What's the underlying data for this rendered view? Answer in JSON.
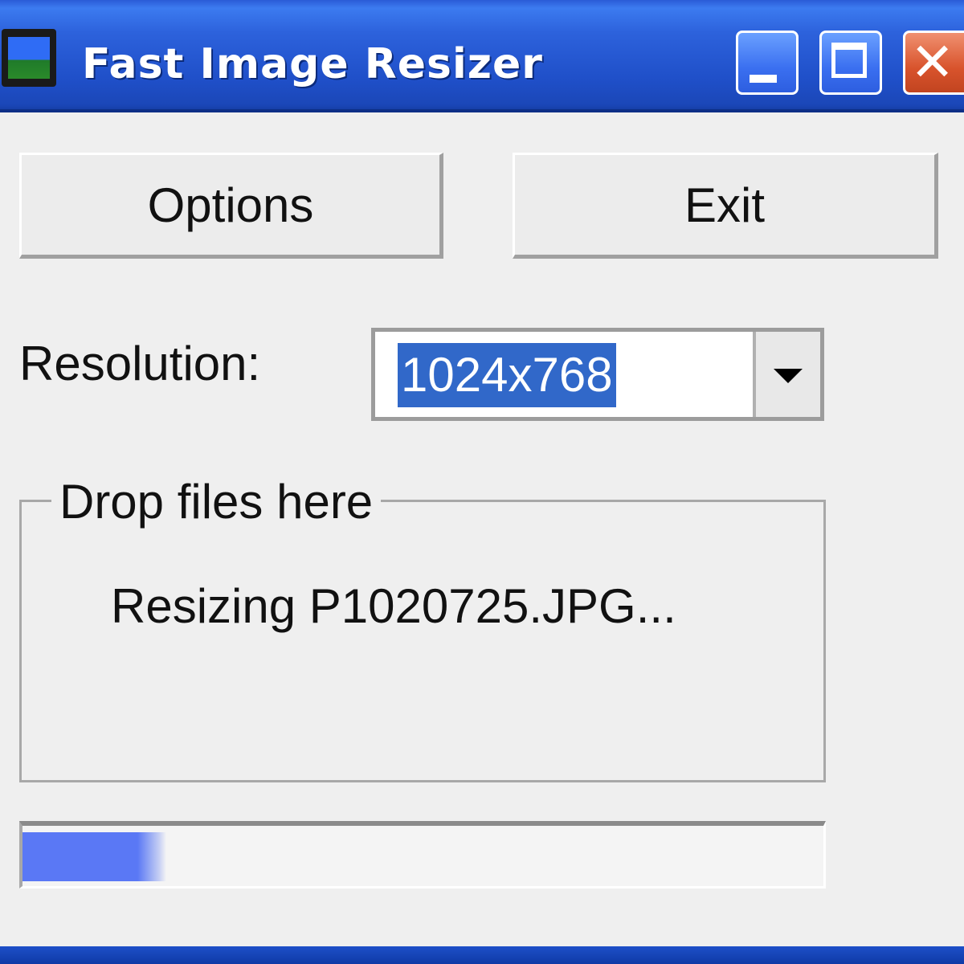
{
  "window": {
    "title": "Fast Image Resizer",
    "icon": "picture-icon",
    "controls": {
      "minimize": "minimize-icon",
      "maximize": "maximize-icon",
      "close": "close-icon",
      "close_glyph": "✕"
    }
  },
  "buttons": {
    "options_label": "Options",
    "exit_label": "Exit"
  },
  "resolution": {
    "label": "Resolution:",
    "selected_value": "1024x768"
  },
  "drop_area": {
    "legend": "Drop files here",
    "status": "Resizing P1020725.JPG..."
  },
  "progress": {
    "fraction": 0.18
  },
  "colors": {
    "titlebar": "#2a5bd7",
    "selection": "#3168c9",
    "progress_fill": "#5a78f5",
    "close_button": "#d8532c"
  }
}
